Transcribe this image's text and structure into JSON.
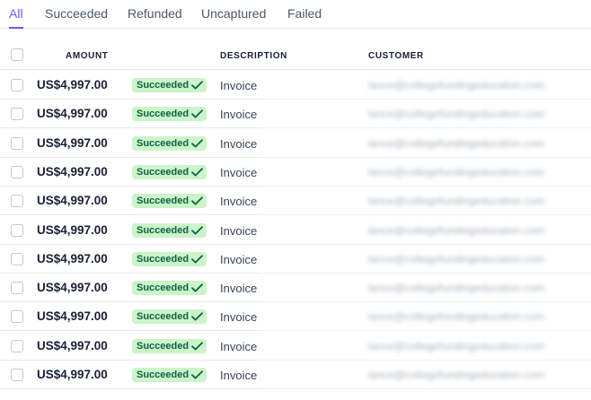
{
  "tabs": [
    {
      "label": "All",
      "active": true
    },
    {
      "label": "Succeeded",
      "active": false
    },
    {
      "label": "Refunded",
      "active": false
    },
    {
      "label": "Uncaptured",
      "active": false
    },
    {
      "label": "Failed",
      "active": false
    }
  ],
  "table": {
    "headers": {
      "amount": "AMOUNT",
      "description": "DESCRIPTION",
      "customer": "CUSTOMER"
    },
    "rows": [
      {
        "amount": "US$4,997.00",
        "status": "Succeeded",
        "description": "Invoice",
        "customer": "lance@collegefundingeducation.com"
      },
      {
        "amount": "US$4,997.00",
        "status": "Succeeded",
        "description": "Invoice",
        "customer": "lance@collegefundingeducation.com"
      },
      {
        "amount": "US$4,997.00",
        "status": "Succeeded",
        "description": "Invoice",
        "customer": "lance@collegefundingeducation.com"
      },
      {
        "amount": "US$4,997.00",
        "status": "Succeeded",
        "description": "Invoice",
        "customer": "lance@collegefundingeducation.com"
      },
      {
        "amount": "US$4,997.00",
        "status": "Succeeded",
        "description": "Invoice",
        "customer": "lance@collegefundingeducation.com"
      },
      {
        "amount": "US$4,997.00",
        "status": "Succeeded",
        "description": "Invoice",
        "customer": "lance@collegefundingeducation.com"
      },
      {
        "amount": "US$4,997.00",
        "status": "Succeeded",
        "description": "Invoice",
        "customer": "lance@collegefundingeducation.com"
      },
      {
        "amount": "US$4,997.00",
        "status": "Succeeded",
        "description": "Invoice",
        "customer": "lance@collegefundingeducation.com"
      },
      {
        "amount": "US$4,997.00",
        "status": "Succeeded",
        "description": "Invoice",
        "customer": "lance@collegefundingeducation.com"
      },
      {
        "amount": "US$4,997.00",
        "status": "Succeeded",
        "description": "Invoice",
        "customer": "lance@collegefundingeducation.com"
      },
      {
        "amount": "US$4,997.00",
        "status": "Succeeded",
        "description": "Invoice",
        "customer": "lance@collegefundingeducation.com"
      }
    ]
  },
  "colors": {
    "accent": "#635bff",
    "badge_bg": "#cbf4c9",
    "badge_text": "#0e6245"
  },
  "icons": {
    "status": "check-icon"
  }
}
